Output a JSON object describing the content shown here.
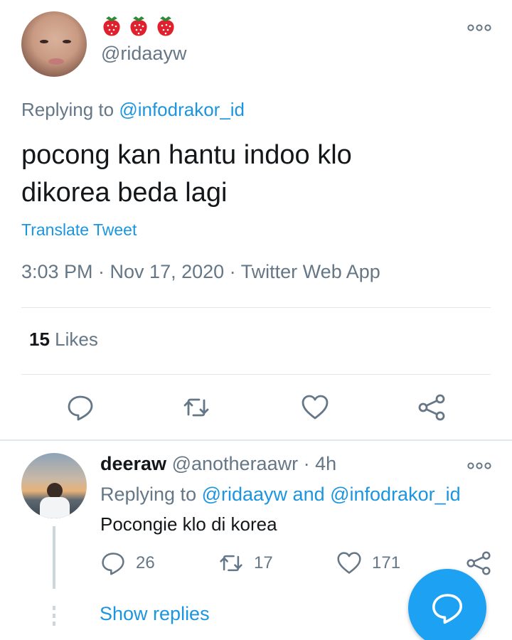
{
  "tweet": {
    "emojis": [
      "strawberry",
      "strawberry",
      "strawberry"
    ],
    "handle": "@ridaayw",
    "replying_prefix": "Replying to",
    "replying_mention": "@infodrakor_id",
    "text_line1": "pocong kan hantu indoo klo",
    "text_line2": "dikorea beda lagi",
    "translate": "Translate Tweet",
    "meta": "3:03 PM · Nov 17, 2020 · Twitter Web App",
    "likes_count": "15",
    "likes_label": "Likes",
    "icons": [
      "reply-icon",
      "retweet-icon",
      "like-icon",
      "share-icon"
    ]
  },
  "reply": {
    "name": "deeraw",
    "handle_time": "@anotheraawr · 4h",
    "replying_prefix": "Replying to",
    "replying_mentions": "@ridaayw and @infodrakor_id",
    "text": "Pocongie klo di korea",
    "reply_count": "26",
    "retweet_count": "17",
    "like_count": "171",
    "show_replies": "Show replies"
  },
  "colors": {
    "accent": "#1da1f2",
    "link": "#1b95e0",
    "secondary_text": "#657786",
    "divider": "#e1e8ed"
  }
}
